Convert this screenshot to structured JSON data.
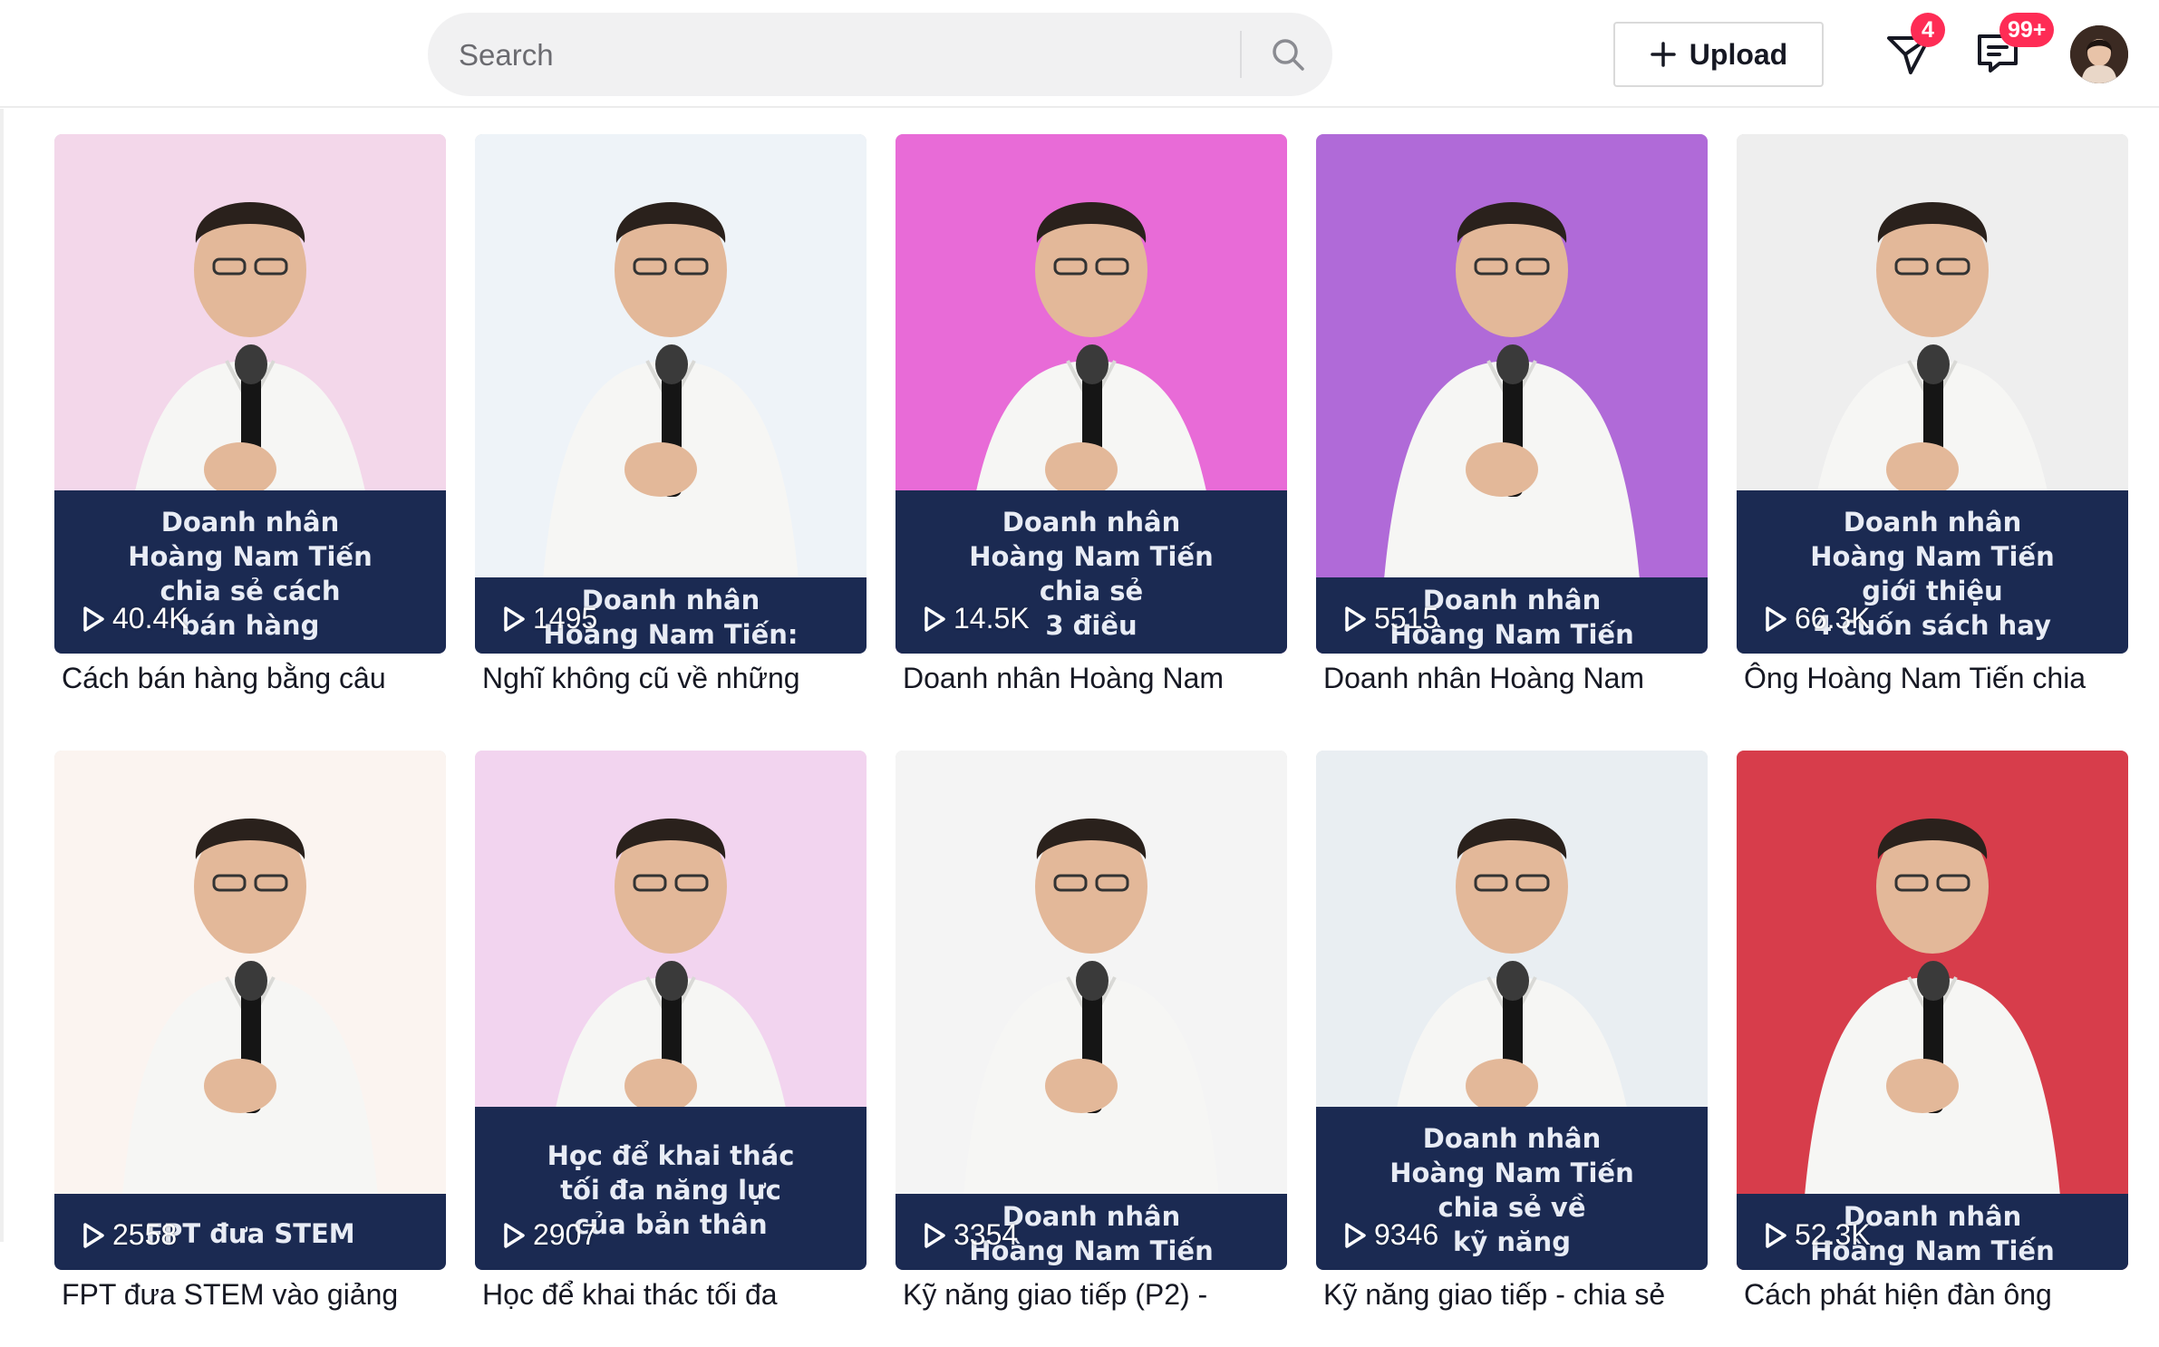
{
  "header": {
    "search": {
      "placeholder": "Search"
    },
    "upload_label": "Upload",
    "inbox_badge": "4",
    "messages_badge": "99+"
  },
  "videos": [
    {
      "views": "40.4K",
      "banner": [
        "Doanh nhân",
        "Hoàng Nam Tiến",
        "chia sẻ cách",
        "bán hàng"
      ],
      "title": "Cách bán hàng bằng câu",
      "bg": "#f3d7ea"
    },
    {
      "views": "1495",
      "banner": [
        "Doanh nhân",
        "Hoàng Nam Tiến:"
      ],
      "title": "Nghĩ không cũ về những",
      "bg": "#eef3f8"
    },
    {
      "views": "14.5K",
      "banner": [
        "Doanh nhân",
        "Hoàng Nam Tiến",
        "chia sẻ",
        "3 điều"
      ],
      "title": "Doanh nhân Hoàng Nam",
      "bg": "#e86bd7"
    },
    {
      "views": "5515",
      "banner": [
        "Doanh nhân",
        "Hoàng Nam Tiến"
      ],
      "title": "Doanh nhân Hoàng Nam",
      "bg": "#b06ad8"
    },
    {
      "views": "66.3K",
      "banner": [
        "Doanh nhân",
        "Hoàng Nam Tiến",
        "giới thiệu",
        "4 cuốn sách hay"
      ],
      "title": "Ông Hoàng Nam Tiến chia",
      "bg": "#eeeeee"
    },
    {
      "views": "2558",
      "banner": [
        "FPT đưa STEM"
      ],
      "title": "FPT đưa STEM vào giảng",
      "bg": "#fbf4f0"
    },
    {
      "views": "2907",
      "banner": [
        "Học để khai thác",
        "tối đa năng lực",
        "của bản thân"
      ],
      "title": "Học để khai thác tối đa",
      "bg": "#f2d4ef"
    },
    {
      "views": "3354",
      "banner": [
        "Doanh nhân",
        "Hoàng Nam Tiến"
      ],
      "title": "Kỹ năng giao tiếp (P2) -",
      "bg": "#f4f4f4"
    },
    {
      "views": "9346",
      "banner": [
        "Doanh nhân",
        "Hoàng Nam Tiến",
        "chia sẻ về",
        "kỹ năng"
      ],
      "title": "Kỹ năng giao tiếp - chia sẻ",
      "bg": "#e9eef2"
    },
    {
      "views": "52.3K",
      "banner": [
        "Doanh nhân",
        "Hoàng Nam Tiến"
      ],
      "title": "Cách phát hiện đàn ông",
      "bg": "#d73d4b"
    }
  ]
}
